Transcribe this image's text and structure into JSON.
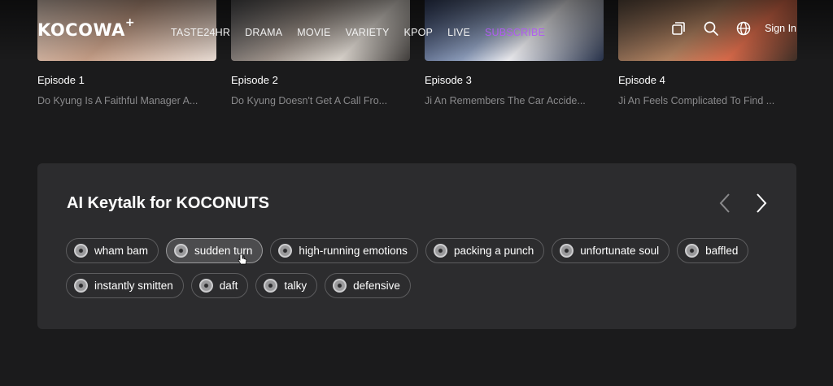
{
  "header": {
    "logo": "KOCOWA",
    "logo_plus": "+",
    "nav": [
      "TASTE24HR",
      "DRAMA",
      "MOVIE",
      "VARIETY",
      "KPOP",
      "LIVE",
      "SUBSCRIBE"
    ],
    "sign_in": "Sign In",
    "icons": [
      "watchlist-icon",
      "search-icon",
      "globe-icon"
    ]
  },
  "episodes": [
    {
      "title": "Episode 1",
      "desc": "Do Kyung Is A Faithful Manager A..."
    },
    {
      "title": "Episode 2",
      "desc": "Do Kyung Doesn't Get A Call Fro..."
    },
    {
      "title": "Episode 3",
      "desc": "Ji An Remembers The Car Accide..."
    },
    {
      "title": "Episode 4",
      "desc": "Ji An Feels Complicated To Find ..."
    }
  ],
  "keytalk": {
    "title": "AI Keytalk for KOCONUTS",
    "row1": [
      "wham bam",
      "sudden turn",
      "high-running emotions",
      "packing a punch",
      "unfortunate soul",
      "baffled"
    ],
    "row2": [
      "instantly smitten",
      "daft",
      "talky",
      "defensive"
    ],
    "active": "sudden turn"
  },
  "colors": {
    "subscribe": "#b05cf0",
    "panel_bg": "#2c2c2e",
    "page_bg": "#1b1b1c"
  }
}
